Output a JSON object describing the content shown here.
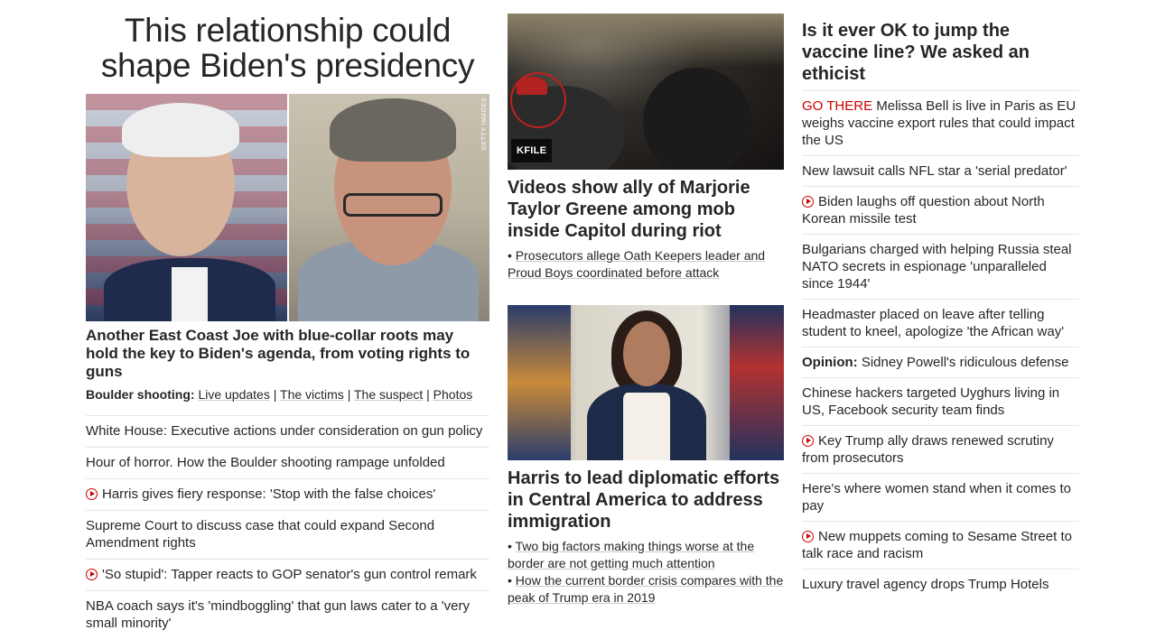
{
  "col1": {
    "hero_title": "This relationship could shape Biden's presidency",
    "image_credit": "GETTY IMAGES",
    "hero_subtitle": "Another East Coast Joe with blue-collar roots may hold the key to Biden's agenda, from voting rights to guns",
    "related_label": "Boulder shooting:",
    "related_links": [
      "Live updates",
      "The victims",
      "The suspect",
      "Photos"
    ],
    "separator": "|",
    "links": [
      {
        "text": "White House: Executive actions under consideration on gun policy",
        "video": false
      },
      {
        "text": "Hour of horror. How the Boulder shooting rampage unfolded",
        "video": false
      },
      {
        "text": "Harris gives fiery response: 'Stop with the false choices'",
        "video": true
      },
      {
        "text": "Supreme Court to discuss case that could expand Second Amendment rights",
        "video": false
      },
      {
        "text": "'So stupid': Tapper reacts to GOP senator's gun control remark",
        "video": true
      },
      {
        "text": "NBA coach says it's 'mindboggling' that gun laws cater to a 'very small minority'",
        "video": false
      }
    ]
  },
  "col2": {
    "card1": {
      "badge": "KFILE",
      "title": "Videos show ally of Marjorie Taylor Greene among mob inside Capitol during riot",
      "bullet_mark": "•",
      "bullets": [
        "Prosecutors allege Oath Keepers leader and Proud Boys coordinated before attack"
      ]
    },
    "card2": {
      "title": "Harris to lead diplomatic efforts in Central America to address immigration",
      "bullet_mark": "•",
      "bullets": [
        "Two big factors making things worse at the border are not getting much attention",
        "How the current border crisis compares with the peak of Trump era in 2019"
      ]
    }
  },
  "col3": {
    "title": "Is it ever OK to jump the vaccine line? We asked an ethicist",
    "links": [
      {
        "kicker": "GO THERE",
        "text": "Melissa Bell is live in Paris as EU weighs vaccine export rules that could impact the US",
        "video": false
      },
      {
        "text": "New lawsuit calls NFL star a 'serial predator'",
        "video": false
      },
      {
        "text": "Biden laughs off question about North Korean missile test",
        "video": true
      },
      {
        "text": "Bulgarians charged with helping Russia steal NATO secrets in espionage 'unparalleled since 1944'",
        "video": false
      },
      {
        "text": "Headmaster placed on leave after telling student to kneel, apologize 'the African way'",
        "video": false
      },
      {
        "bold": "Opinion:",
        "text": "Sidney Powell's ridiculous defense",
        "video": false
      },
      {
        "text": "Chinese hackers targeted Uyghurs living in US, Facebook security team finds",
        "video": false
      },
      {
        "text": "Key Trump ally draws renewed scrutiny from prosecutors",
        "video": true
      },
      {
        "text": "Here's where women stand when it comes to pay",
        "video": false
      },
      {
        "text": "New muppets coming to Sesame Street to talk race and racism",
        "video": true
      },
      {
        "text": "Luxury travel agency drops Trump Hotels",
        "video": false
      }
    ]
  },
  "colors": {
    "accent_red": "#cc0000",
    "text": "#262626",
    "divider": "#e6e6e6"
  },
  "icons": {
    "video": "play-circle-icon"
  }
}
